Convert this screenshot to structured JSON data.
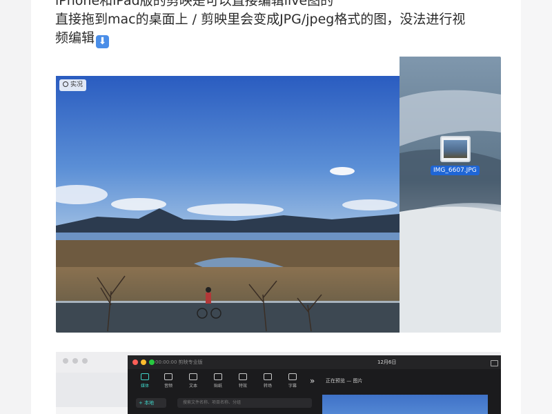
{
  "article": {
    "line1": "iPhone和iPad版的剪映是可以直接编辑live图的",
    "line2": "直接拖到mac的桌面上 / 剪映里会变成JPG/jpeg格式的图，没法进行视",
    "line3": "频编辑"
  },
  "photo1": {
    "live_badge": "实况",
    "file_name": "IMG_6607.JPG"
  },
  "capcut": {
    "window_title": "00:00:00  剪映专业版",
    "date": "12月6日",
    "tools": [
      "媒体",
      "音频",
      "文本",
      "贴纸",
      "特效",
      "转场",
      "字幕"
    ],
    "side_tab": "+ 本地",
    "search_placeholder": "搜索文件名称、项目名称、分组",
    "preview_header": "正在预览 — 图片"
  },
  "icons": [
    "down-arrow-emoji-icon",
    "live-photo-icon",
    "file-icon",
    "more-chevron-icon"
  ],
  "colors": {
    "accent": "#3fd4c8",
    "file_label_bg": "#1f66d6"
  }
}
